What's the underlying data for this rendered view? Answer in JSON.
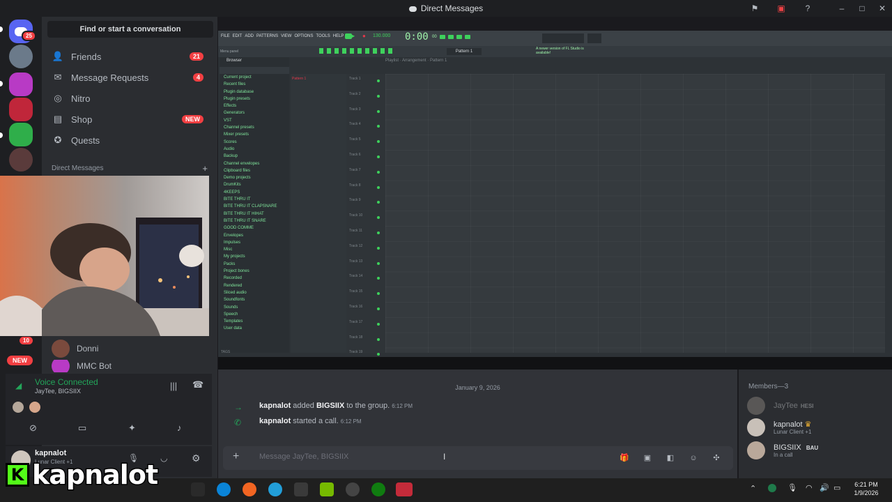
{
  "window": {
    "title": "Direct Messages"
  },
  "rail": {
    "home_badge": "25"
  },
  "sidebar": {
    "search_label": "Find or start a conversation",
    "nav": [
      {
        "label": "Friends",
        "badge": "21"
      },
      {
        "label": "Message Requests",
        "badge": "4"
      },
      {
        "label": "Nitro",
        "badge": ""
      },
      {
        "label": "Shop",
        "badge": "NEW"
      },
      {
        "label": "Quests",
        "badge": ""
      }
    ],
    "dm_header": "Direct Messages",
    "dm_add": "+",
    "side_badges": {
      "count": "10",
      "new": "NEW"
    },
    "dms": [
      {
        "name": "Donni"
      },
      {
        "name": "MMC Bot"
      }
    ]
  },
  "voice": {
    "status": "Voice Connected",
    "channel": "JayTee, BIGSIIX"
  },
  "user": {
    "name": "kapnalot",
    "status": "Lunar Client +1"
  },
  "fl": {
    "menu": [
      "FILE",
      "EDIT",
      "ADD",
      "PATTERNS",
      "VIEW",
      "OPTIONS",
      "TOOLS",
      "HELP"
    ],
    "tempo": "130.000",
    "time": "0:00",
    "time_ms": "00",
    "pattern": "Pattern 1",
    "hint": "Menu panel",
    "breadcrumb": "Playlist · Arrangement · Pattern 1",
    "notice": "A newer version of FL Studio is available!",
    "browser_label": "Browser",
    "browser": [
      "Current project",
      "Recent files",
      "Plugin database",
      "Plugin presets",
      "Effects",
      "Generators",
      "VST",
      "Channel presets",
      "Mixer presets",
      "Scores",
      "Audio",
      "Backup",
      "Channel envelopes",
      "Clipboard files",
      "Demo projects",
      "DrumKits",
      "4KEEPS",
      "BITE THRU IT",
      "BITE THRU IT CLAPSNARE",
      "BITE THRU IT HIHAT",
      "BITE THRU IT SNARE",
      "GOOD COMME",
      "Envelopes",
      "Impulses",
      "Misc",
      "My projects",
      "Packs",
      "Project bones",
      "Recorded",
      "Rendered",
      "Sliced audio",
      "Soundfonts",
      "Sounds",
      "Speech",
      "Templates",
      "User data"
    ],
    "playlist_pattern": "Pattern 1",
    "tracks": [
      "Track 1",
      "Track 2",
      "Track 3",
      "Track 4",
      "Track 5",
      "Track 6",
      "Track 7",
      "Track 8",
      "Track 9",
      "Track 10",
      "Track 11",
      "Track 12",
      "Track 13",
      "Track 14",
      "Track 15",
      "Track 16",
      "Track 17",
      "Track 18",
      "Track 19"
    ],
    "tag": "TAGS"
  },
  "chat": {
    "date": "January 9, 2026",
    "messages": [
      {
        "author": "kapnalot",
        "action": "added",
        "target": "BIGSIIX",
        "rest": "to the group.",
        "time": "6:12 PM"
      },
      {
        "author": "kapnalot",
        "action": "started a call.",
        "target": "",
        "rest": "",
        "time": "6:12 PM"
      }
    ],
    "placeholder": "Message JayTee, BIGSIIX"
  },
  "members": {
    "header": "Members—3",
    "list": [
      {
        "name": "JayTee",
        "tag": "HESI",
        "status": ""
      },
      {
        "name": "kapnalot",
        "tag": "",
        "status": "Lunar Client +1"
      },
      {
        "name": "BIGSIIX",
        "tag": "BAU",
        "status": "In a call"
      }
    ]
  },
  "taskbar": {
    "time": "6:21 PM",
    "date": "1/9/2026"
  },
  "overlay": {
    "logo": "K",
    "name": "kapnalot"
  }
}
